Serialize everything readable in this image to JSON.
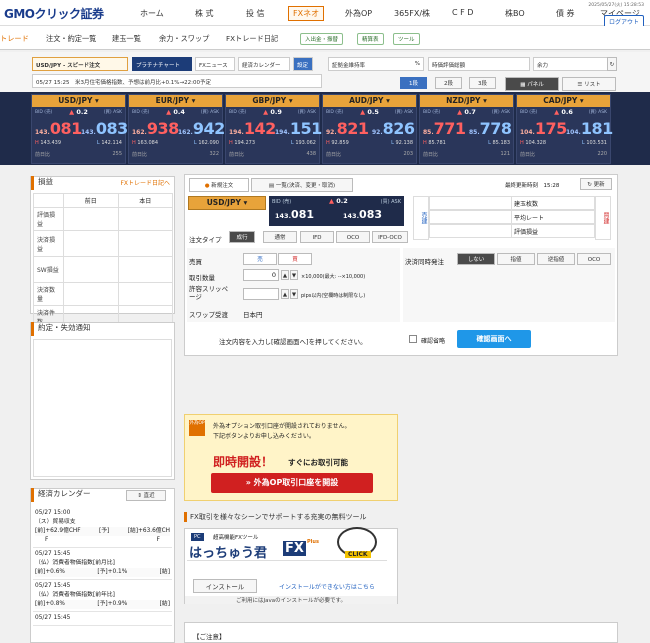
{
  "logo": "GMOクリック証券",
  "nav": [
    "ホーム",
    "株 式",
    "投 信",
    "FXネオ",
    "外為OP",
    "365FX/株",
    "C F D",
    "株BO",
    "債 券",
    "マイページ"
  ],
  "datetime": "2025/05/27(火) 15:28:53",
  "logout": "ログアウト",
  "sub": {
    "brand": "トレード",
    "items": [
      "注文・約定一覧",
      "建玉一覧",
      "余力・スワップ",
      "FXトレード日記"
    ],
    "pills": [
      "入出金・振替",
      "精算表",
      "ツール"
    ]
  },
  "toolbar": {
    "speed_order": "USD/JPY - スピード注文",
    "platinum": "プラチナチャート",
    "fxnews": "FXニュース",
    "calendar": "経済カレンダー",
    "settings": "設定",
    "ticker": "05/27 15:25　米3月住宅価格指数、予想は前月比+0.1%→22:00予定",
    "margin_ratio": "証拠金維持率",
    "margin_unit": "%",
    "valuation": "時価評価総額",
    "surplus": "余力",
    "tabs": [
      "1段",
      "2段",
      "3段"
    ],
    "panel": "パネル",
    "list": "リスト"
  },
  "rates": [
    {
      "pair": "USD/JPY",
      "change": "0.2",
      "bid_small": "143.",
      "bid_big": "081",
      "ask_small": "143.",
      "ask_big": "083",
      "high": "143.439",
      "low": "142.114",
      "prev": "255"
    },
    {
      "pair": "EUR/JPY",
      "change": "0.4",
      "bid_small": "162.",
      "bid_big": "938",
      "ask_small": "162.",
      "ask_big": "942",
      "high": "163.084",
      "low": "162.090",
      "prev": "322"
    },
    {
      "pair": "GBP/JPY",
      "change": "0.9",
      "bid_small": "194.",
      "bid_big": "142",
      "ask_small": "194.",
      "ask_big": "151",
      "high": "194.273",
      "low": "193.062",
      "prev": "438"
    },
    {
      "pair": "AUD/JPY",
      "change": "0.5",
      "bid_small": "92.",
      "bid_big": "821",
      "ask_small": "92.",
      "ask_big": "826",
      "high": "92.859",
      "low": "92.138",
      "prev": "203"
    },
    {
      "pair": "NZD/JPY",
      "change": "0.7",
      "bid_small": "85.",
      "bid_big": "771",
      "ask_small": "85.",
      "ask_big": "778",
      "high": "85.781",
      "low": "85.183",
      "prev": "121"
    },
    {
      "pair": "CAD/JPY",
      "change": "0.6",
      "bid_small": "104.",
      "bid_big": "175",
      "ask_small": "104.",
      "ask_big": "181",
      "high": "104.328",
      "low": "103.531",
      "prev": "220"
    }
  ],
  "tile_labels": {
    "bid": "BID (売)",
    "ask": "(買) ASK",
    "h": "H",
    "l": "L",
    "prev": "前日比"
  },
  "pnl": {
    "title": "損益",
    "link": "FXトレード日記へ",
    "cols": [
      "前日",
      "本日"
    ],
    "rows": [
      "評価損益",
      "決済損益",
      "SW損益",
      "決済数量",
      "決済件数"
    ]
  },
  "notify": {
    "title": "約定・失効通知"
  },
  "econ": {
    "title": "経済カレンダー",
    "btn": "直近",
    "items": [
      {
        "time": "05/27 15:00",
        "title": "（ス）貿易収支",
        "a": "[前]+62.9億CHF",
        "b": "[予]",
        "c": "[結]+63.6億CH",
        "d": "F",
        "e": "F"
      },
      {
        "time": "05/27 15:45",
        "title": "（仏）消費者物価指数[前月比]",
        "a": "[前]+0.6%",
        "b": "[予]+0.1%",
        "c": "[結]"
      },
      {
        "time": "05/27 15:45",
        "title": "（仏）消費者物価指数[前年比]",
        "a": "[前]+0.8%",
        "b": "[予]+0.9%",
        "c": "[結]"
      },
      {
        "time": "05/27 15:45",
        "title": ""
      }
    ]
  },
  "order": {
    "tab1": "新規注文",
    "tab2": "一覧(決済、変更・取消)",
    "last_update_label": "最終更新時刻",
    "last_update": "15:28",
    "refresh": "更新",
    "pair": "USD/JPY",
    "bid_label": "BID (売)",
    "ask_label": "(買) ASK",
    "change": "0.2",
    "bid_small": "143.",
    "bid_big": "081",
    "ask_small": "143.",
    "ask_big": "083",
    "positions": [
      "建玉枚数",
      "平均レート",
      "評価損益"
    ],
    "sell_side": "売建",
    "buy_side": "買建",
    "type_label": "注文タイプ",
    "types": [
      "成行",
      "通常",
      "IFD",
      "OCO",
      "IFD-OCO"
    ],
    "side_label": "売買",
    "sell": "売",
    "buy": "買",
    "qty_label": "取引数量",
    "qty": "0",
    "qty_note": "×10,000(最大: --×10,000)",
    "slip_label": "許容スリッページ",
    "slip_note": "pips以内(空欄時は制限なし)",
    "swap_label": "スワップ受渡",
    "swap": "日本円",
    "settle_label": "決済同時発注",
    "settle_opts": [
      "しない",
      "指値",
      "逆指値",
      "OCO"
    ],
    "confirm_text": "注文内容を入力し[確認画面へ]を押してください。",
    "skip": "確認省略",
    "confirm_btn": "確認画面へ"
  },
  "ad1": {
    "line1": "外為オプション取引口座が開設されておりません。",
    "line2": "下記ボタンよりお申し込みください。",
    "big": "即時開設！",
    "sub": "すぐにお取引可能",
    "cta": "外為OP取引口座を開設",
    "badge": "外為OP"
  },
  "tools": {
    "title": "FX取引を様々なシーンでサポートする充実の無料ツール",
    "tag": "PC",
    "desc": "超高機能FXツール",
    "brand": "はっちゅう君",
    "fx": "FX",
    "plus": "Plus",
    "click": "CLICK",
    "install": "インストール",
    "cant": "インストールができない方はこちら",
    "java": "ご利用にはJavaのインストールが必要です。"
  },
  "notes": "【ご注意】",
  "colors": {
    "accent": "#e07000",
    "header": "#1f2b4a",
    "tile": "#e8a33a",
    "bid": "#ff6060",
    "ask": "#8fc4ff",
    "confirm": "#1f97e8"
  }
}
